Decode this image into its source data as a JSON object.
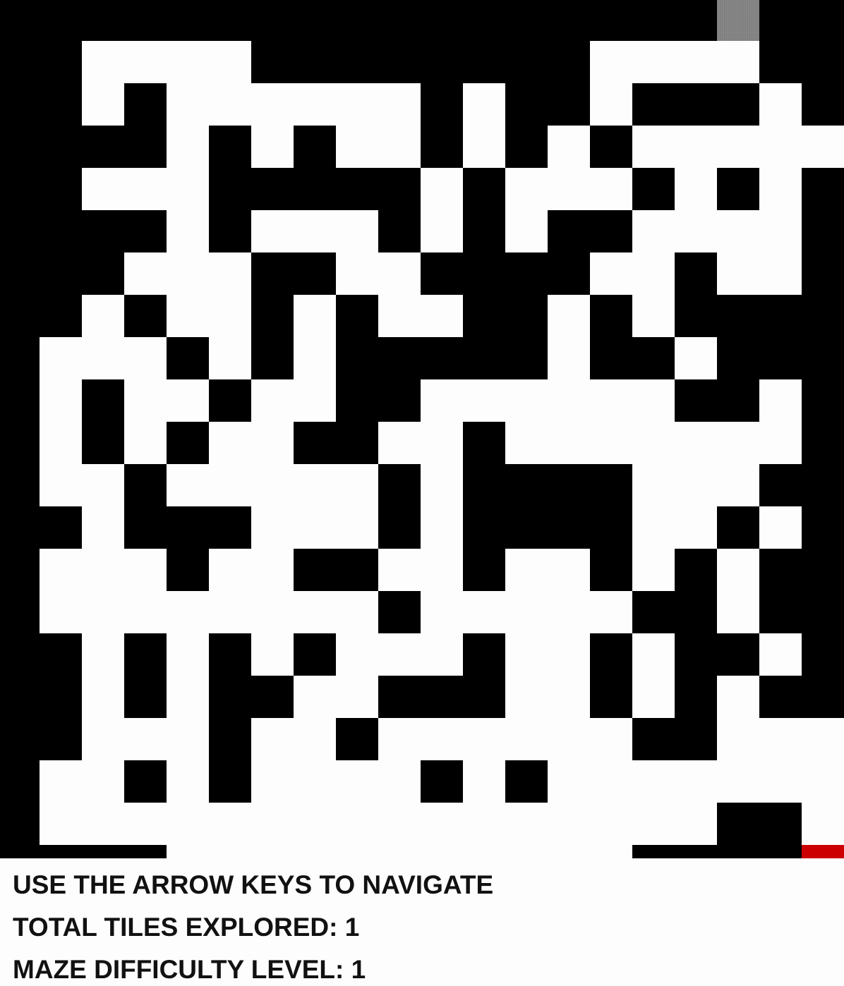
{
  "maze": {
    "rows": [
      "#################X##",
      "##xxxx########xxxx##",
      "##x#xxxxxx#x##x###x#",
      "####x#x#xx#x#x#xxxxx",
      "##xxx#####x#xxx#x#x#",
      "####x#xxx#x#x##xxxx#",
      "###xxx##xx####xx#xx#",
      "##x#xx#x#xx##x#x####",
      "#xxx#x#x#####x##x###",
      "#x#xx#xx##xxxxxx##x#",
      "#x#x#xx##xx#xxxxxxx#",
      "#xx#xxxxx#x####xxx##",
      "##x###xxx#x####xx#x#",
      "#xxx#xx##xx#xx#x#x##",
      "#xxxxxxxx#xxxxx##x##",
      "##x#x#x#xxx#xx#x##x#",
      "##x#x##xx###xx#x#x##",
      "##xxx#xx#xxxxxx##xxx",
      "#xx#x#xxxx#x#xxxxxxx",
      "#xxxxxxxxxxxxxxxx##x",
      "####xxxxxxxxxxx####R",
      "####################"
    ],
    "cell_legend": {
      "#": "wall",
      "x": "path",
      "R": "player",
      "X": "exit"
    },
    "colors": {
      "wall": "#000000",
      "path": "#fdfdfd",
      "player": "#cc0000",
      "exit": "#888888"
    }
  },
  "hud": {
    "instructions": "USE THE ARROW KEYS TO NAVIGATE",
    "tiles_explored": "TOTAL TILES EXPLORED: 1",
    "difficulty": "MAZE DIFFICULTY LEVEL: 1"
  }
}
